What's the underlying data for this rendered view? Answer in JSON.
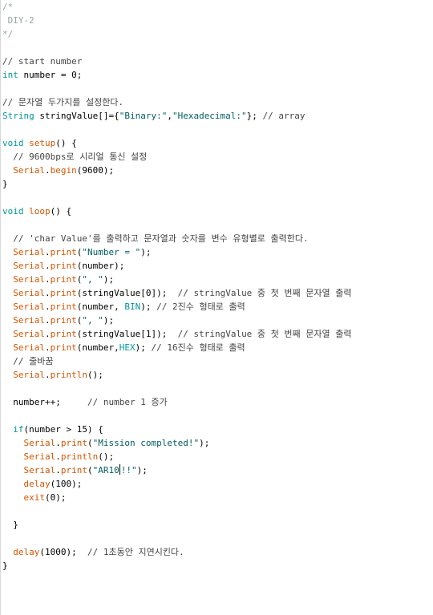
{
  "editor": {
    "lines": [
      [
        {
          "t": "/*",
          "c": "cm"
        }
      ],
      [
        {
          "t": " DIY-2",
          "c": "cm"
        }
      ],
      [
        {
          "t": "*/",
          "c": "cm"
        }
      ],
      [],
      [
        {
          "t": "// start number",
          "c": "cm-ko"
        }
      ],
      [
        {
          "t": "int",
          "c": "kw-type"
        },
        {
          "t": " number = 0;",
          "c": ""
        }
      ],
      [],
      [
        {
          "t": "// 문자열 두가지를 설정한다.",
          "c": "cm-ko"
        }
      ],
      [
        {
          "t": "String",
          "c": "kw-type"
        },
        {
          "t": " stringValue[]={",
          "c": ""
        },
        {
          "t": "\"Binary:\"",
          "c": "str"
        },
        {
          "t": ",",
          "c": ""
        },
        {
          "t": "\"Hexadecimal:\"",
          "c": "str"
        },
        {
          "t": "}; ",
          "c": ""
        },
        {
          "t": "// array",
          "c": "cm-ko"
        }
      ],
      [],
      [
        {
          "t": "void",
          "c": "kw-type"
        },
        {
          "t": " ",
          "c": ""
        },
        {
          "t": "setup",
          "c": "fn"
        },
        {
          "t": "() {",
          "c": ""
        }
      ],
      [
        {
          "t": "  // 9600bps로 시리얼 통신 설정",
          "c": "cm-ko"
        }
      ],
      [
        {
          "t": "  ",
          "c": ""
        },
        {
          "t": "Serial",
          "c": "fn"
        },
        {
          "t": ".",
          "c": ""
        },
        {
          "t": "begin",
          "c": "fn"
        },
        {
          "t": "(9600);",
          "c": ""
        }
      ],
      [
        {
          "t": "}",
          "c": ""
        }
      ],
      [],
      [
        {
          "t": "void",
          "c": "kw-type"
        },
        {
          "t": " ",
          "c": ""
        },
        {
          "t": "loop",
          "c": "fn"
        },
        {
          "t": "() {",
          "c": ""
        }
      ],
      [],
      [
        {
          "t": "  // 'char Value'를 출력하고 문자열과 숫자를 변수 유형별로 출력한다.",
          "c": "cm-ko"
        }
      ],
      [
        {
          "t": "  ",
          "c": ""
        },
        {
          "t": "Serial",
          "c": "fn"
        },
        {
          "t": ".",
          "c": ""
        },
        {
          "t": "print",
          "c": "fn"
        },
        {
          "t": "(",
          "c": ""
        },
        {
          "t": "\"Number = \"",
          "c": "str"
        },
        {
          "t": ");",
          "c": ""
        }
      ],
      [
        {
          "t": "  ",
          "c": ""
        },
        {
          "t": "Serial",
          "c": "fn"
        },
        {
          "t": ".",
          "c": ""
        },
        {
          "t": "print",
          "c": "fn"
        },
        {
          "t": "(number);",
          "c": ""
        }
      ],
      [
        {
          "t": "  ",
          "c": ""
        },
        {
          "t": "Serial",
          "c": "fn"
        },
        {
          "t": ".",
          "c": ""
        },
        {
          "t": "print",
          "c": "fn"
        },
        {
          "t": "(",
          "c": ""
        },
        {
          "t": "\", \"",
          "c": "str"
        },
        {
          "t": ");",
          "c": ""
        }
      ],
      [
        {
          "t": "  ",
          "c": ""
        },
        {
          "t": "Serial",
          "c": "fn"
        },
        {
          "t": ".",
          "c": ""
        },
        {
          "t": "print",
          "c": "fn"
        },
        {
          "t": "(stringValue[0]);  ",
          "c": ""
        },
        {
          "t": "// stringValue 중 첫 번째 문자열 출력",
          "c": "cm-ko"
        }
      ],
      [
        {
          "t": "  ",
          "c": ""
        },
        {
          "t": "Serial",
          "c": "fn"
        },
        {
          "t": ".",
          "c": ""
        },
        {
          "t": "print",
          "c": "fn"
        },
        {
          "t": "(number, ",
          "c": ""
        },
        {
          "t": "BIN",
          "c": "const"
        },
        {
          "t": "); ",
          "c": ""
        },
        {
          "t": "// 2진수 형태로 출력",
          "c": "cm-ko"
        }
      ],
      [
        {
          "t": "  ",
          "c": ""
        },
        {
          "t": "Serial",
          "c": "fn"
        },
        {
          "t": ".",
          "c": ""
        },
        {
          "t": "print",
          "c": "fn"
        },
        {
          "t": "(",
          "c": ""
        },
        {
          "t": "\", \"",
          "c": "str"
        },
        {
          "t": ");",
          "c": ""
        }
      ],
      [
        {
          "t": "  ",
          "c": ""
        },
        {
          "t": "Serial",
          "c": "fn"
        },
        {
          "t": ".",
          "c": ""
        },
        {
          "t": "print",
          "c": "fn"
        },
        {
          "t": "(stringValue[1]);  ",
          "c": ""
        },
        {
          "t": "// stringValue 중 첫 번째 문자열 출력",
          "c": "cm-ko"
        }
      ],
      [
        {
          "t": "  ",
          "c": ""
        },
        {
          "t": "Serial",
          "c": "fn"
        },
        {
          "t": ".",
          "c": ""
        },
        {
          "t": "print",
          "c": "fn"
        },
        {
          "t": "(number,",
          "c": ""
        },
        {
          "t": "HEX",
          "c": "const"
        },
        {
          "t": "); ",
          "c": ""
        },
        {
          "t": "// 16진수 형태로 출력",
          "c": "cm-ko"
        }
      ],
      [
        {
          "t": "  // 줄바꿈",
          "c": "cm-ko"
        }
      ],
      [
        {
          "t": "  ",
          "c": ""
        },
        {
          "t": "Serial",
          "c": "fn"
        },
        {
          "t": ".",
          "c": ""
        },
        {
          "t": "println",
          "c": "fn"
        },
        {
          "t": "();",
          "c": ""
        }
      ],
      [],
      [
        {
          "t": "  number++;     ",
          "c": ""
        },
        {
          "t": "// number 1 증가",
          "c": "cm-ko"
        }
      ],
      [],
      [
        {
          "t": "  ",
          "c": ""
        },
        {
          "t": "if",
          "c": "kw"
        },
        {
          "t": "(number > 15) {",
          "c": ""
        }
      ],
      [
        {
          "t": "    ",
          "c": ""
        },
        {
          "t": "Serial",
          "c": "fn"
        },
        {
          "t": ".",
          "c": ""
        },
        {
          "t": "print",
          "c": "fn"
        },
        {
          "t": "(",
          "c": ""
        },
        {
          "t": "\"Mission completed!\"",
          "c": "str"
        },
        {
          "t": ");",
          "c": ""
        }
      ],
      [
        {
          "t": "    ",
          "c": ""
        },
        {
          "t": "Serial",
          "c": "fn"
        },
        {
          "t": ".",
          "c": ""
        },
        {
          "t": "println",
          "c": "fn"
        },
        {
          "t": "();",
          "c": ""
        }
      ],
      [
        {
          "t": "    ",
          "c": ""
        },
        {
          "t": "Serial",
          "c": "fn"
        },
        {
          "t": ".",
          "c": ""
        },
        {
          "t": "print",
          "c": "fn"
        },
        {
          "t": "(",
          "c": ""
        },
        {
          "t": "\"AR10",
          "c": "str"
        },
        {
          "t": "",
          "c": "caret"
        },
        {
          "t": "!!\"",
          "c": "str"
        },
        {
          "t": ");",
          "c": ""
        }
      ],
      [
        {
          "t": "    ",
          "c": ""
        },
        {
          "t": "delay",
          "c": "fn"
        },
        {
          "t": "(100);",
          "c": ""
        }
      ],
      [
        {
          "t": "    ",
          "c": ""
        },
        {
          "t": "exit",
          "c": "fn"
        },
        {
          "t": "(0);",
          "c": ""
        }
      ],
      [],
      [
        {
          "t": "  }",
          "c": ""
        }
      ],
      [],
      [
        {
          "t": "  ",
          "c": ""
        },
        {
          "t": "delay",
          "c": "fn"
        },
        {
          "t": "(1000);  ",
          "c": ""
        },
        {
          "t": "// 1초동안 지연시킨다.",
          "c": "cm-ko"
        }
      ],
      [
        {
          "t": "}",
          "c": ""
        }
      ]
    ]
  }
}
